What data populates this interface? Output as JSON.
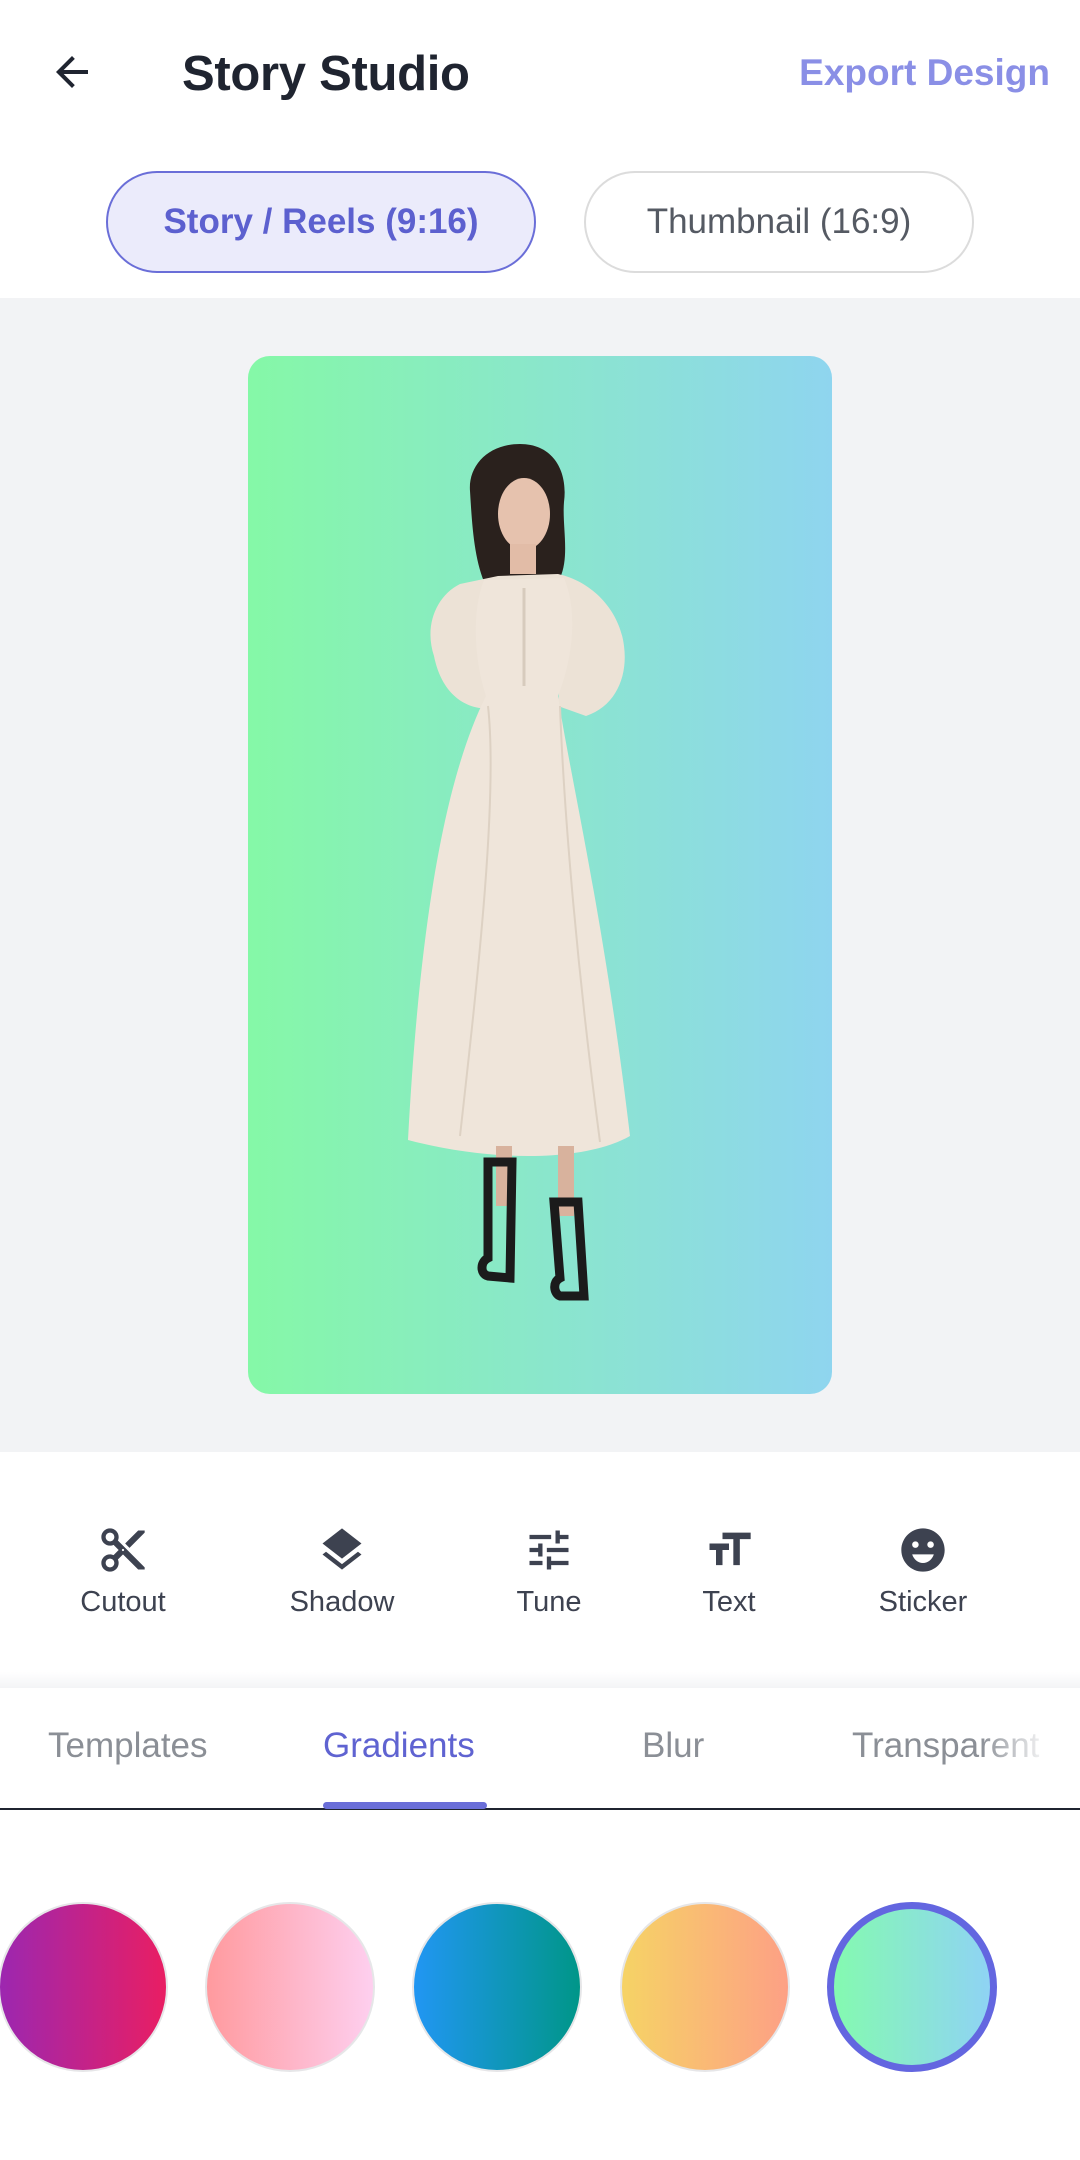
{
  "header": {
    "title": "Story Studio",
    "export_label": "Export Design",
    "back_icon": "arrow-left-icon"
  },
  "formats": [
    {
      "label": "Story / Reels (9:16)",
      "active": true
    },
    {
      "label": "Thumbnail (16:9)",
      "active": false
    }
  ],
  "canvas": {
    "background_gradient": [
      "#85f8a7",
      "#8fd5ef"
    ],
    "subject": "model-cutout-photo"
  },
  "tools": [
    {
      "label": "Cutout",
      "icon": "scissors-icon"
    },
    {
      "label": "Shadow",
      "icon": "layers-icon"
    },
    {
      "label": "Tune",
      "icon": "sliders-icon"
    },
    {
      "label": "Text",
      "icon": "text-size-icon"
    },
    {
      "label": "Sticker",
      "icon": "smiley-icon"
    }
  ],
  "tabs": [
    {
      "label": "Templates",
      "active": false
    },
    {
      "label": "Gradients",
      "active": true
    },
    {
      "label": "Blur",
      "active": false
    },
    {
      "label": "Transparent",
      "active": false
    }
  ],
  "gradients": [
    {
      "from": "#9c27b0",
      "to": "#e91e63",
      "selected": false
    },
    {
      "from": "#ff9a9e",
      "to": "#fecfef",
      "selected": false
    },
    {
      "from": "#2196f3",
      "to": "#009688",
      "selected": false
    },
    {
      "from": "#f6d365",
      "to": "#fda085",
      "selected": false
    },
    {
      "from": "#84fab0",
      "to": "#8fd3f4",
      "selected": true
    }
  ],
  "colors": {
    "accent": "#6366e0",
    "accent_light": "#8a8fe6"
  }
}
